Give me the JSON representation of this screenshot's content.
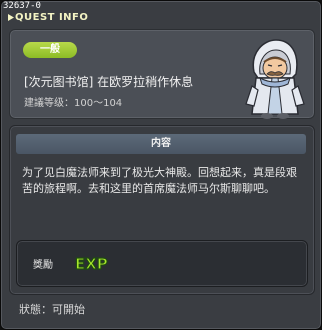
{
  "window": {
    "id": "32637-0",
    "title": "QUEST INFO"
  },
  "quest": {
    "category_badge": "一般",
    "name": "[次元图书馆] 在欧罗拉稍作休息",
    "level": "建議等级：100～104"
  },
  "content": {
    "header": "内容",
    "description": "为了见白魔法师来到了极光大神殿。回想起来，真是段艰苦的旅程啊。去和这里的首席魔法师马尔斯聊聊吧。"
  },
  "reward": {
    "label": "獎勵",
    "icon": "exp-icon",
    "icon_text": "EXP"
  },
  "status": {
    "text": "狀態：可開始"
  },
  "colors": {
    "badge": "#9bc92f",
    "exp": "#a8e82a",
    "title": "#f4f4c4"
  }
}
